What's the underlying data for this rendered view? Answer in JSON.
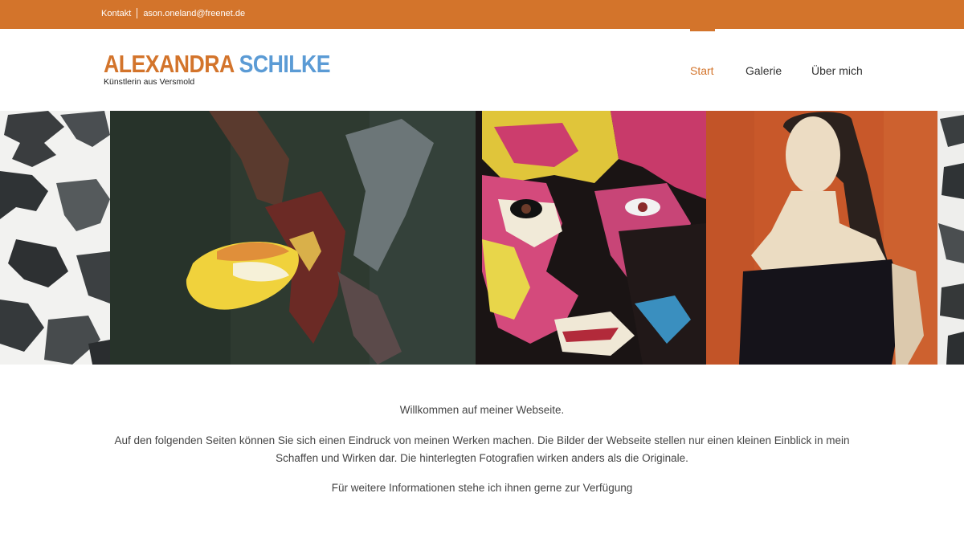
{
  "topbar": {
    "contact_label": "Kontakt",
    "email": "ason.oneland@freenet.de"
  },
  "logo": {
    "first_name": "ALEXANDRA",
    "last_name": "SCHILKE",
    "tagline": "Künstlerin aus Versmold"
  },
  "nav": {
    "items": [
      {
        "label": "Start",
        "active": true
      },
      {
        "label": "Galerie",
        "active": false
      },
      {
        "label": "Über mich",
        "active": false
      }
    ]
  },
  "banner": {
    "artworks": [
      "abstract-black-white",
      "orchid-painting",
      "pop-art-face",
      "woman-black-dress-orange"
    ]
  },
  "content": {
    "welcome": "Willkommen auf meiner Webseite.",
    "intro": "Auf den folgenden Seiten können Sie sich einen Eindruck von meinen Werken machen. Die Bilder der Webseite stellen nur einen kleinen Einblick in mein Schaffen und Wirken dar. Die hinterlegten Fotografien wirken anders als die Originale.",
    "info": "Für weitere Informationen stehe ich ihnen gerne zur Verfügung"
  },
  "colors": {
    "accent": "#d3742b",
    "logo_blue": "#5b9bd5"
  }
}
